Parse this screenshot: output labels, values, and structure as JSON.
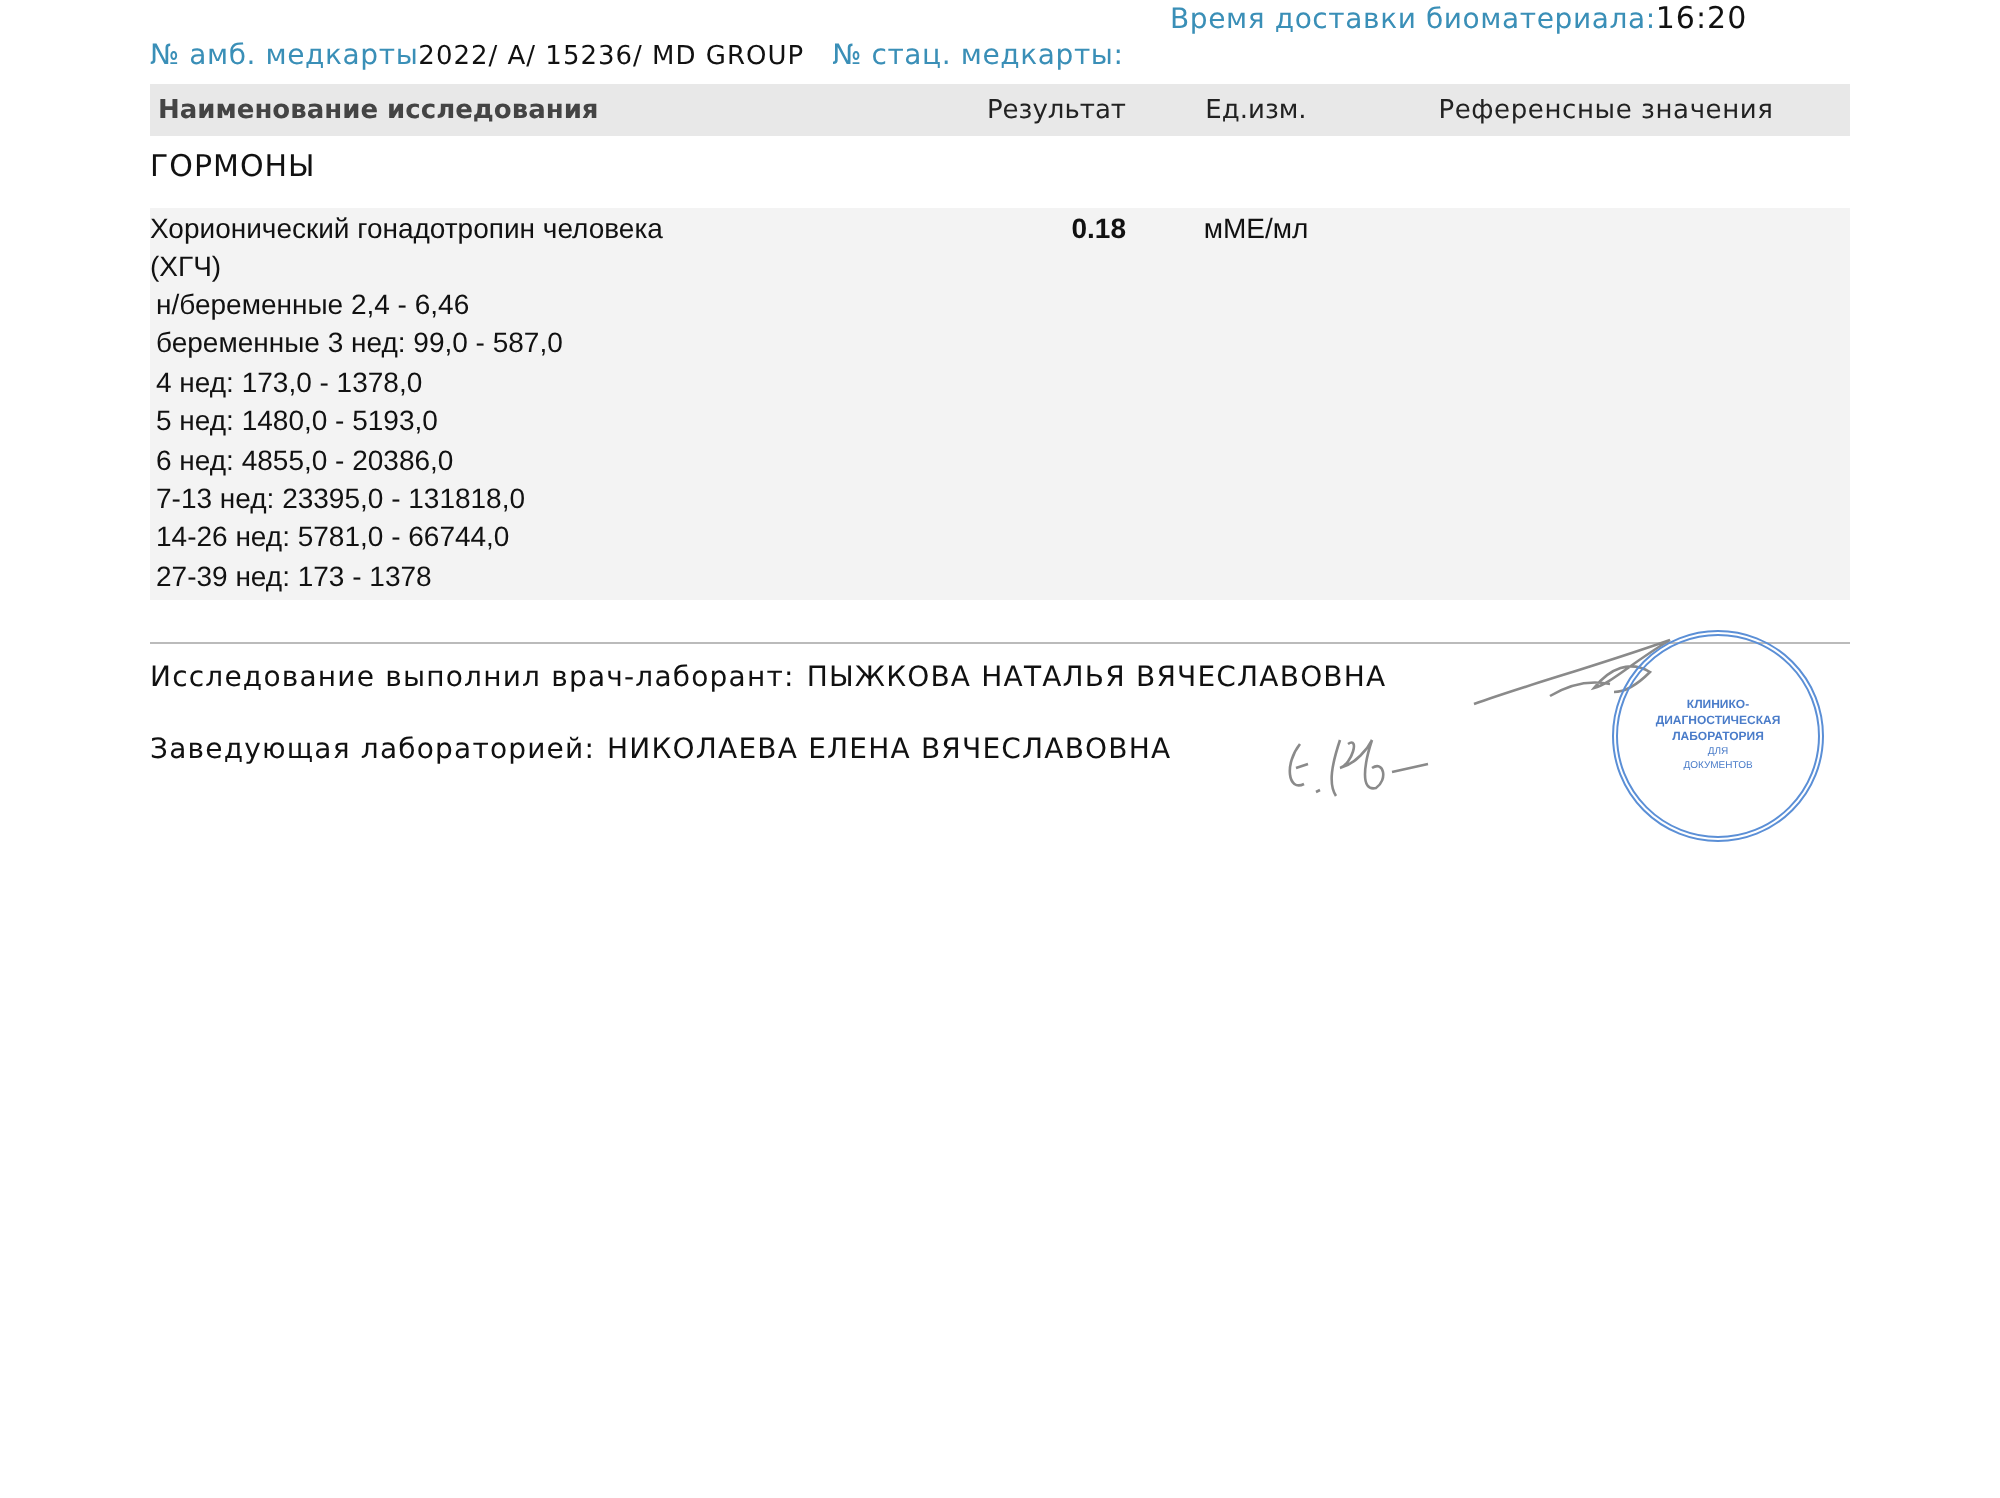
{
  "header": {
    "delivery_time_label": "Время доставки биоматериала:",
    "delivery_time": "16:20",
    "outpatient_card_label": "№ амб. медкарты",
    "outpatient_card": "2022/ A/ 15236/ MD GROUP",
    "inpatient_card_label": "№ стац. медкарты:"
  },
  "table": {
    "columns": [
      "Наименование исследования",
      "Результат",
      "Ед.изм.",
      "Референсные значения"
    ],
    "section": "ГОРМОНЫ",
    "rows": [
      {
        "name": "Хорионический гонадотропин человека (ХГЧ)",
        "result": "0.18",
        "unit": "мМЕ/мл",
        "notes": [
          "н/беременные 2,4 - 6,46",
          "беременные  3 нед: 99,0 - 587,0",
          "4 нед: 173,0 - 1378,0",
          "5 нед: 1480,0 - 5193,0",
          "6 нед: 4855,0 - 20386,0",
          "7-13 нед: 23395,0 - 131818,0",
          "14-26 нед: 5781,0 - 66744,0",
          "27-39 нед: 173 - 1378"
        ]
      }
    ]
  },
  "signatures": [
    {
      "label": "Исследование выполнил врач-лаборант:",
      "name": "ПЫЖКОВА НАТАЛЬЯ ВЯЧЕСЛАВОВНА"
    },
    {
      "label": "Заведующая лабораторией:",
      "name": "НИКОЛАЕВА ЕЛЕНА ВЯЧЕСЛАВОВНА"
    }
  ],
  "stamp": {
    "lines": [
      "КЛИНИКО-",
      "ДИАГНОСТИЧЕСКАЯ",
      "ЛАБОРАТОРИЯ",
      "ДЛЯ",
      "ДОКУМЕНТОВ"
    ]
  }
}
